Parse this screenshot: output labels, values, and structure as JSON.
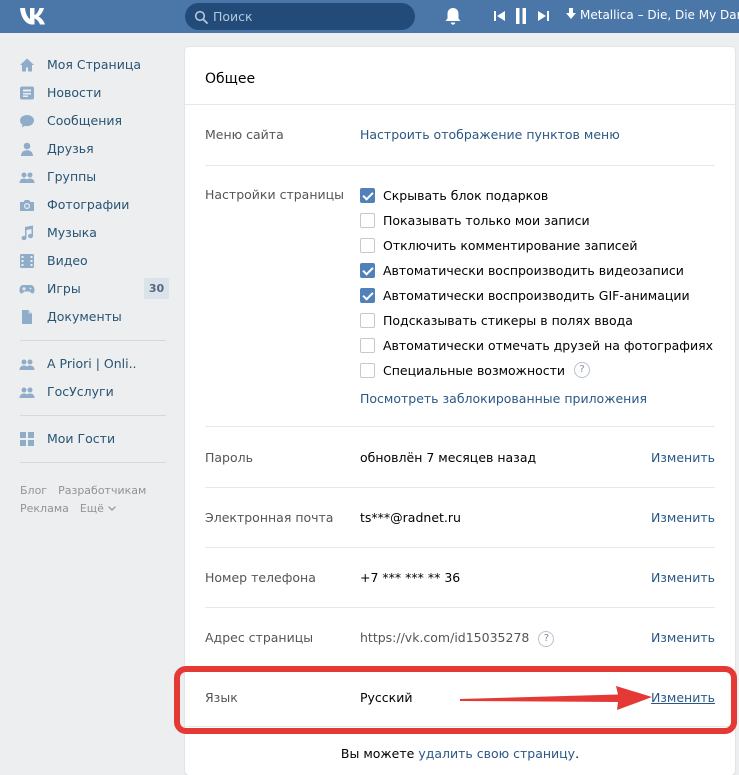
{
  "topbar": {
    "search_placeholder": "Поиск",
    "now_playing": "Metallica – Die, Die My Darling"
  },
  "sidebar": {
    "items": [
      {
        "label": "Моя Страница",
        "icon": "home-icon"
      },
      {
        "label": "Новости",
        "icon": "news-icon"
      },
      {
        "label": "Сообщения",
        "icon": "messages-icon"
      },
      {
        "label": "Друзья",
        "icon": "friends-icon"
      },
      {
        "label": "Группы",
        "icon": "groups-icon"
      },
      {
        "label": "Фотографии",
        "icon": "camera-icon"
      },
      {
        "label": "Музыка",
        "icon": "music-icon"
      },
      {
        "label": "Видео",
        "icon": "video-icon"
      },
      {
        "label": "Игры",
        "icon": "gamepad-icon",
        "badge": "30"
      },
      {
        "label": "Документы",
        "icon": "document-icon"
      }
    ],
    "apps": [
      {
        "label": "A Priori | Onli..",
        "icon": "app-people-icon"
      },
      {
        "label": "ГосУслуги",
        "icon": "app-people-icon"
      }
    ],
    "extra": [
      {
        "label": "Мои Гости",
        "icon": "grid-icon"
      }
    ],
    "footer": {
      "blog": "Блог",
      "developers": "Разработчикам",
      "ads": "Реклама",
      "more": "Ещё"
    }
  },
  "settings": {
    "title": "Общее",
    "menu": {
      "label": "Меню сайта",
      "link": "Настроить отображение пунктов меню"
    },
    "page_settings": {
      "label": "Настройки страницы",
      "options": [
        {
          "text": "Скрывать блок подарков",
          "checked": true
        },
        {
          "text": "Показывать только мои записи",
          "checked": false
        },
        {
          "text": "Отключить комментирование записей",
          "checked": false
        },
        {
          "text": "Автоматически воспроизводить видеозаписи",
          "checked": true
        },
        {
          "text": "Автоматически воспроизводить GIF-анимации",
          "checked": true
        },
        {
          "text": "Подсказывать стикеры в полях ввода",
          "checked": false
        },
        {
          "text": "Автоматически отмечать друзей на фотографиях",
          "checked": false
        },
        {
          "text": "Специальные возможности",
          "checked": false,
          "help": "?"
        }
      ],
      "blocked_apps_link": "Посмотреть заблокированные приложения"
    },
    "password": {
      "label": "Пароль",
      "value": "обновлён 7 месяцев назад",
      "action": "Изменить"
    },
    "email": {
      "label": "Электронная почта",
      "value": "ts***@radnet.ru",
      "action": "Изменить"
    },
    "phone": {
      "label": "Номер телефона",
      "value": "+7 *** *** ** 36",
      "action": "Изменить"
    },
    "address": {
      "label": "Адрес страницы",
      "value": "https://vk.com/id15035278",
      "help": "?",
      "action": "Изменить"
    },
    "language": {
      "label": "Язык",
      "value": "Русский",
      "action": "Изменить"
    },
    "delete": {
      "prefix": "Вы можете ",
      "link": "удалить свою страницу",
      "suffix": "."
    }
  },
  "colors": {
    "header": "#4a76a8",
    "link": "#2a5885",
    "checkbox_on": "#5181b8",
    "annotation": "#e53935"
  }
}
